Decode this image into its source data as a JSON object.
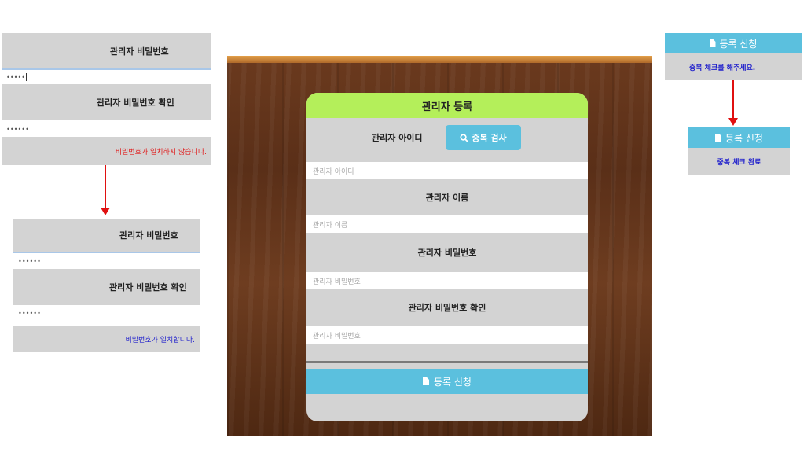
{
  "left_top": {
    "pw_label": "관리자 비밀번호",
    "pw_value": "•••••",
    "confirm_label": "관리자 비밀번호 확인",
    "confirm_value": "••••••",
    "message": "비밀번호가 일치하지 않습니다."
  },
  "left_bottom": {
    "pw_label": "관리자 비밀번호",
    "pw_value": "••••••",
    "confirm_label": "관리자 비밀번호 확인",
    "confirm_value": "••••••",
    "message": "비밀번호가 일치합니다."
  },
  "form": {
    "title": "관리자 등록",
    "id_label": "관리자 아이디",
    "dup_check_button": "중복 검사",
    "id_placeholder": "관리자 아이디",
    "name_label": "관리자 이름",
    "name_placeholder": "관리자 이름",
    "pw_label": "관리자 비밀번호",
    "pw_placeholder": "관리자 비밀번호",
    "confirm_label": "관리자 비밀번호 확인",
    "confirm_placeholder": "관리자 비밀번호",
    "submit_button": "등록 신청"
  },
  "right_top": {
    "button": "등록 신청",
    "message": "중복 체크를 해주세요."
  },
  "right_bottom": {
    "button": "등록 신청",
    "message": "중복 체크 완료"
  },
  "colors": {
    "header_green": "#b4ef5a",
    "button_blue": "#5bc0de",
    "error_red": "#e02020",
    "ok_blue": "#2222cc",
    "arrow_red": "#e01010"
  }
}
